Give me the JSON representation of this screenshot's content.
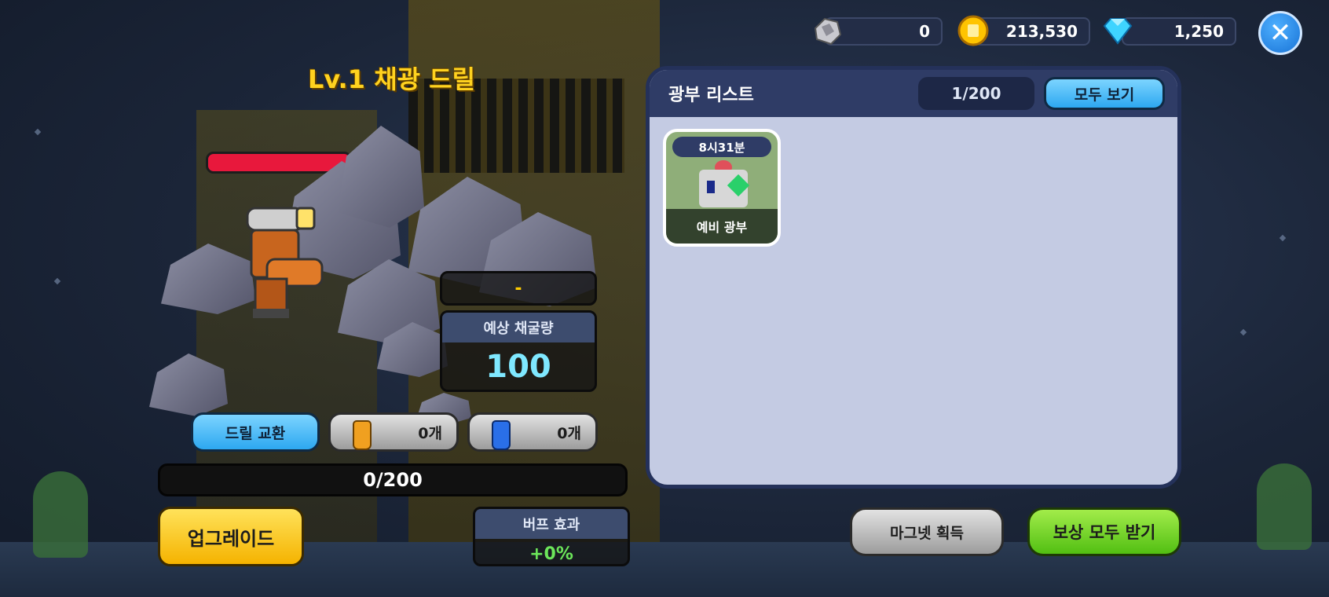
{
  "currencies": {
    "ore": {
      "icon": "ore-icon",
      "value": "0"
    },
    "gold": {
      "icon": "gold-coin-icon",
      "value": "213,530"
    },
    "gem": {
      "icon": "diamond-icon",
      "value": "1,250"
    }
  },
  "close_label": "✕",
  "drill": {
    "title": "Lv.1 채광 드릴",
    "status": "-",
    "yield_label": "예상 채굴량",
    "yield_value": "100"
  },
  "actions": {
    "swap_drill": "드릴 교환",
    "item1_count": "0개",
    "item2_count": "0개",
    "progress": "0/200",
    "upgrade": "업그레이드",
    "buff_label": "버프 효과",
    "buff_value": "+0%"
  },
  "ore_list": {
    "title": "광부 리스트",
    "count": "1/200",
    "view_all": "모두 보기",
    "cards": [
      {
        "time": "8시31분",
        "name": "예비 광부"
      }
    ]
  },
  "bottom_buttons": {
    "magnet": "마그넷 획득",
    "claim_all": "보상 모두 받기"
  },
  "colors": {
    "accent_yellow": "#ffd21f",
    "yield_cyan": "#7fe8ff",
    "buff_green": "#6ce65a",
    "hp_red": "#e8183c",
    "panel_bg": "#c4cbe3",
    "panel_header": "#2f3c66"
  }
}
